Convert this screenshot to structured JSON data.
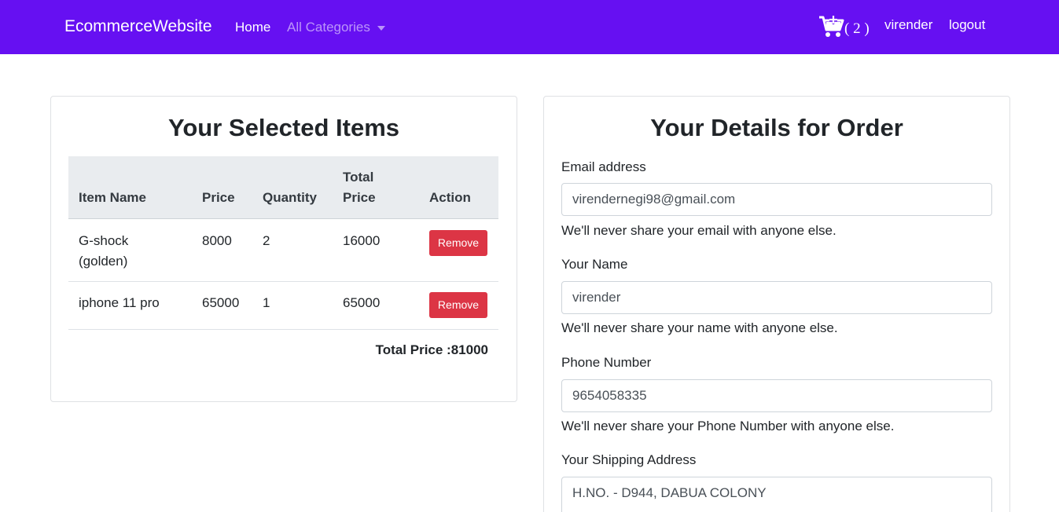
{
  "navbar": {
    "brand": "EcommerceWebsite",
    "home": "Home",
    "categories": "All Categories",
    "cart_count": "( 2 )",
    "user": "virender",
    "logout": "logout",
    "background_color": "#6610f2"
  },
  "cart": {
    "title": "Your Selected Items",
    "columns": {
      "item_name": "Item Name",
      "price": "Price",
      "quantity": "Quantity",
      "total_price_line1": "Total",
      "total_price_line2": "Price",
      "action": "Action"
    },
    "rows": [
      {
        "name_line1": "G-shock",
        "name_line2": "(golden)",
        "price": "8000",
        "quantity": "2",
        "total": "16000",
        "action": "Remove"
      },
      {
        "name_line1": "iphone 11 pro",
        "name_line2": "",
        "price": "65000",
        "quantity": "1",
        "total": "65000",
        "action": "Remove"
      }
    ],
    "grand_total": "Total Price :81000",
    "remove_color": "#dc3545"
  },
  "order_form": {
    "title": "Your Details for Order",
    "email": {
      "label": "Email address",
      "value": "virendernegi98@gmail.com",
      "help": "We'll never share your email with anyone else."
    },
    "name": {
      "label": "Your Name",
      "value": "virender",
      "help": "We'll never share your name with anyone else."
    },
    "phone": {
      "label": "Phone Number",
      "value": "9654058335",
      "help": "We'll never share your Phone Number with anyone else."
    },
    "address": {
      "label": "Your Shipping Address",
      "value": "H.NO. - D944, DABUA COLONY"
    }
  }
}
